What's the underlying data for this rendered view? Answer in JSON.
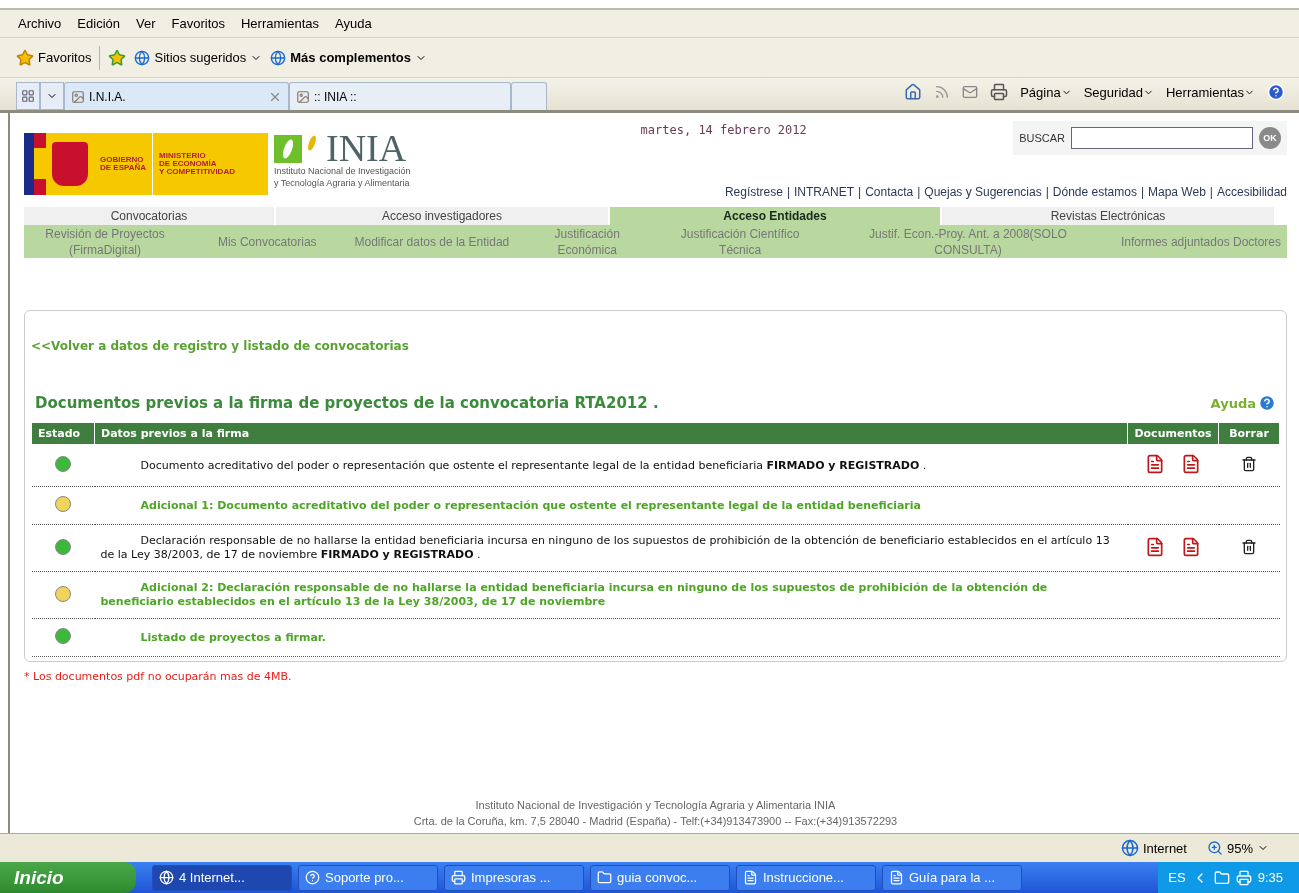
{
  "menu_bar": [
    "Archivo",
    "Edición",
    "Ver",
    "Favoritos",
    "Herramientas",
    "Ayuda"
  ],
  "favorites_bar": {
    "favorites": "Favoritos",
    "items": [
      {
        "label": "Sitios sugeridos",
        "bold": false
      },
      {
        "label": "Más complementos",
        "bold": true
      }
    ]
  },
  "tabs": [
    {
      "label": "I.N.I.A.",
      "selected": true
    },
    {
      "label": ":: INIA ::",
      "selected": false
    }
  ],
  "command_bar": [
    "Página",
    "Seguridad",
    "Herramientas"
  ],
  "page": {
    "date": "martes, 14 febrero 2012",
    "search": {
      "label": "BUSCAR",
      "button": "OK"
    },
    "gov_logo": {
      "line1": "GOBIERNO",
      "line2": "DE ESPAÑA",
      "ministry": [
        "MINISTERIO",
        "DE ECONOMÍA",
        "Y COMPETITIVIDAD"
      ]
    },
    "inia_logo": {
      "name": "INIA",
      "subtitle": [
        "Instituto Nacional de Investigación",
        "y Tecnología Agraria y Alimentaria"
      ]
    },
    "link_separator": "|",
    "links": [
      "Regístrese",
      "INTRANET",
      "Contacta",
      "Quejas y Sugerencias",
      "Dónde estamos",
      "Mapa Web",
      "Accesibilidad"
    ],
    "main_nav": [
      {
        "label": "Convocatorias",
        "selected": false
      },
      {
        "label": "Acceso investigadores",
        "selected": false
      },
      {
        "label": "Acceso Entidades",
        "selected": true
      },
      {
        "label": "Revistas Electrónicas",
        "selected": false
      }
    ],
    "sub_nav": [
      "Revisión de Proyectos (FirmaDigital)",
      "Mis Convocatorias",
      "Modificar datos de la Entidad",
      "Justificación Económica",
      "Justificación Científico Técnica",
      "Justif. Econ.-Proy. Ant. a 2008(SOLO CONSULTA)",
      "Informes adjuntados Doctores"
    ],
    "back_link": "<<Volver a datos de registro y listado de convocatorias",
    "heading": "Documentos previos a la firma de proyectos de la convocatoria RTA2012 .",
    "help": "Ayuda",
    "table": {
      "columns": [
        "Estado",
        "Datos previos a la firma",
        "Documentos",
        "Borrar"
      ],
      "rows": [
        {
          "kind": "signed",
          "color": "#3cb83c",
          "text": "Documento acreditativo del poder o representación que ostente el representante legal de la entidad beneficiaria **FIRMADO y REGISTRADO** .",
          "documents": true,
          "delete": true
        },
        {
          "kind": "pending",
          "color": "#f2d35a",
          "text": "Adicional 1: Documento acreditativo del poder o representación que ostente el representante legal de la entidad beneficiaria",
          "documents": false,
          "delete": false
        },
        {
          "kind": "signed",
          "color": "#3cb83c",
          "text": "Declaración responsable de no hallarse la entidad beneficiaria incursa en ninguno de los supuestos de prohibición de la obtención de beneficiario establecidos en el artículo 13 de la Ley 38/2003, de 17 de noviembre **FIRMADO y REGISTRADO** .",
          "documents": true,
          "delete": true
        },
        {
          "kind": "pending",
          "color": "#f2d35a",
          "text": "Adicional 2: Declaración responsable de no hallarse la entidad beneficiaria incursa en ninguno de los supuestos de prohibición de la obtención de beneficiario establecidos en el artículo 13 de la Ley 38/2003, de 17 de noviembre",
          "documents": false,
          "delete": false
        },
        {
          "kind": "pending",
          "color": "#3cb83c",
          "text": "Listado de proyectos a firmar.",
          "documents": false,
          "delete": false
        }
      ]
    },
    "note": "* Los documentos pdf no ocuparán mas de 4MB.",
    "footer": [
      "Instituto Nacional de Investigación y Tecnología Agraria y Alimentaria INIA",
      "Crta. de la Coruña, km. 7,5 28040 - Madrid (España) - Telf:(+34)913473900 -- Fax:(+34)913572293"
    ]
  },
  "status_bar": {
    "zone": "Internet",
    "zoom": "95%"
  },
  "taskbar": {
    "start": "Inicio",
    "tasks": [
      {
        "label": "4 Internet...",
        "kind": "ie",
        "selected": true
      },
      {
        "label": "Soporte pro...",
        "kind": "app",
        "selected": false
      },
      {
        "label": "Impresoras ...",
        "kind": "printer",
        "selected": false
      },
      {
        "label": "guia convoc...",
        "kind": "folder",
        "selected": false
      },
      {
        "label": "Instruccione...",
        "kind": "doc",
        "selected": false
      },
      {
        "label": "Guía para la ...",
        "kind": "doc",
        "selected": false
      }
    ],
    "language": "ES",
    "clock": "9:35"
  }
}
